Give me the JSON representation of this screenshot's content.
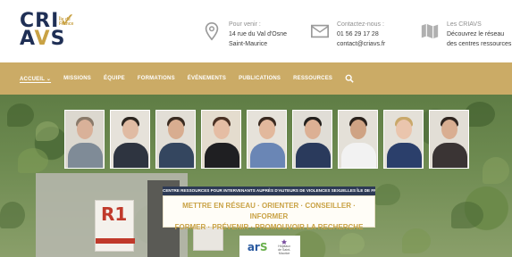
{
  "brand": {
    "logo_line1": "CRI",
    "logo_line1_accent": "✓",
    "logo_line2": "A",
    "logo_line2_accent": "V",
    "logo_line2_end": "S",
    "logo_tiny": "Île de France",
    "accent_color": "#c9a245",
    "navy_color": "#1f2f55"
  },
  "header": {
    "visit": {
      "icon": "location-pin-icon",
      "label": "Pour venir :",
      "line1": "14 rue du Val d'Osne",
      "line2": "Saint-Maurice"
    },
    "contact": {
      "icon": "envelope-icon",
      "label": "Contactez-nous :",
      "line1": "01 56 29 17 28",
      "line2": "contact@criavs.fr"
    },
    "criavs": {
      "icon": "map-icon",
      "label": "Les CRIAVS",
      "line1": "Découvrez le réseau",
      "line2": "des centres ressources"
    }
  },
  "nav": {
    "bar_color": "#cbab66",
    "items": [
      "ACCUEIL ⌄",
      "MISSIONS",
      "ÉQUIPE",
      "FORMATIONS",
      "ÉVÉNEMENTS",
      "PUBLICATIONS",
      "RESSOURCES"
    ],
    "search_icon": "search-icon"
  },
  "hero": {
    "sign_r1": "R1",
    "banner_top": "CENTRE RESSOURCES POUR INTERVENANTS AUPRÈS D'AUTEURS DE VIOLENCES SEXUELLES ÎLE DE FRANCE",
    "banner_line1": "METTRE EN RÉSEAU  ·  ORIENTER  ·  CONSEILLER  ·  INFORMER",
    "banner_line2": "FORMER  ·  PRÉVENIR  ·  PROMOUVOIR LA RECHERCHE",
    "partner_ars_1": "ar",
    "partner_ars_2": "S",
    "partner_hospital": "Hôpitaux de Saint-Maurice"
  }
}
